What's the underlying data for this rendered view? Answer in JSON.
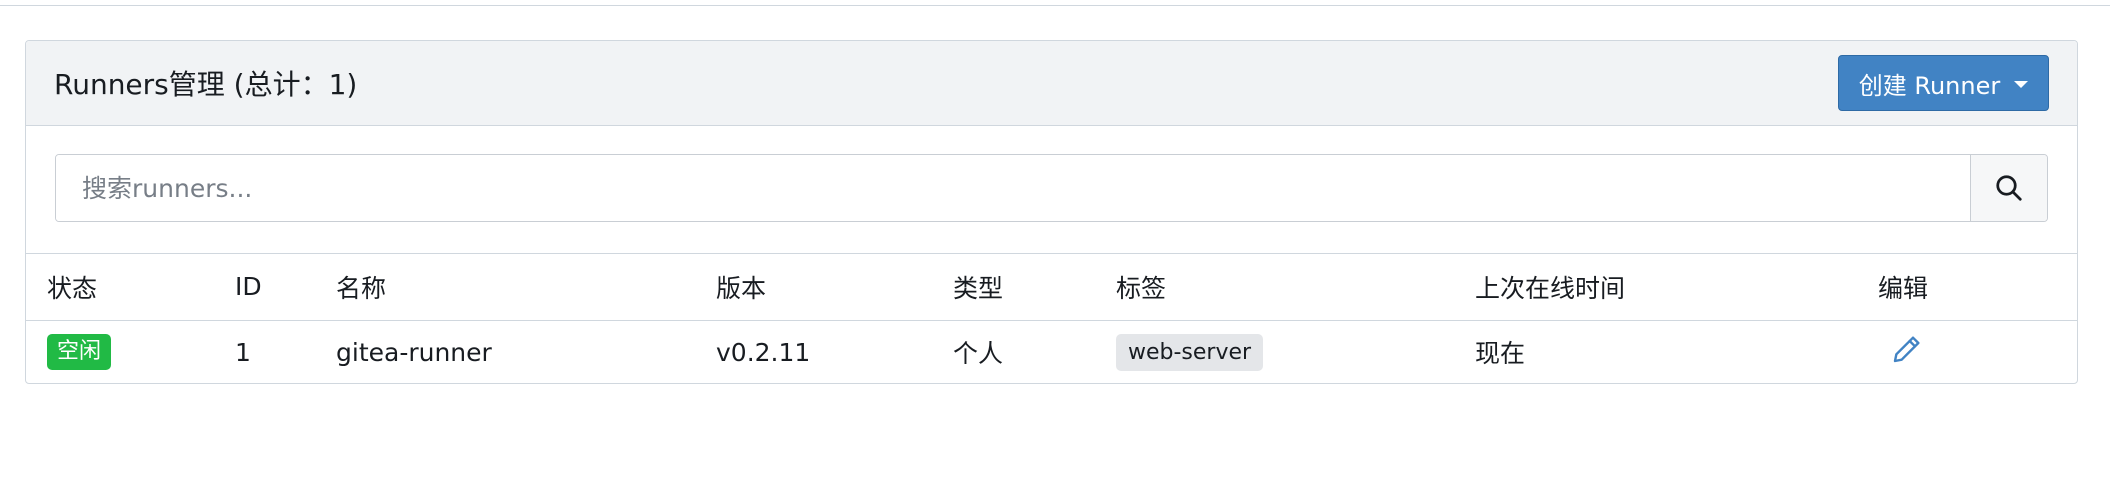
{
  "panel": {
    "title": "Runners管理 (总计：1)",
    "create_button_label": "创建 Runner"
  },
  "search": {
    "placeholder": "搜索runners...",
    "value": ""
  },
  "table": {
    "headers": [
      "状态",
      "ID",
      "名称",
      "版本",
      "类型",
      "标签",
      "上次在线时间",
      "编辑"
    ],
    "rows": [
      {
        "status": "空闲",
        "id": "1",
        "name": "gitea-runner",
        "version": "v0.2.11",
        "type": "个人",
        "label": "web-server",
        "last_online": "现在",
        "edit_icon": "pencil-icon"
      }
    ]
  },
  "colors": {
    "accent": "#4183c4",
    "status_idle": "#21ba45",
    "label_bg": "#e4e6e9"
  },
  "icons": {
    "search": "search-icon",
    "dropdown": "caret-down-icon",
    "edit": "pencil-icon"
  }
}
